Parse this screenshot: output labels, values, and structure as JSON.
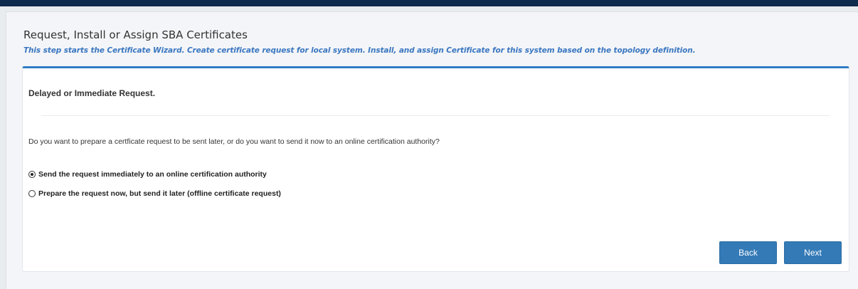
{
  "header": {
    "title": "Request, Install or Assign SBA Certificates",
    "subtitle": "This step starts the Certificate Wizard. Create certificate request for local system. Install, and assign Certificate for this system based on the topology definition."
  },
  "panel": {
    "heading": "Delayed or Immediate Request.",
    "question": "Do you want to prepare a certficate request to be sent later, or do you want to send it now to an online certification authority?",
    "options": [
      {
        "label": "Send the request immediately to an online certification authority",
        "checked": true
      },
      {
        "label": "Prepare the request now, but send it later (offline certificate request)",
        "checked": false
      }
    ]
  },
  "buttons": {
    "back_label": "Back",
    "next_label": "Next"
  },
  "colors": {
    "topbar": "#0e2a4c",
    "accent": "#2e7cc5",
    "subtitle": "#3a77c0",
    "button": "#337ab7"
  }
}
